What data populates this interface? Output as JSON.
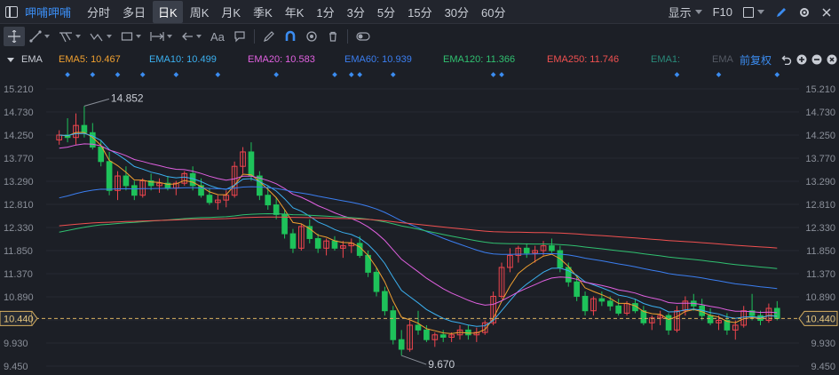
{
  "topbar": {
    "stock_name": "呷哺呷哺",
    "periods": [
      "分时",
      "多日",
      "日K",
      "周K",
      "月K",
      "季K",
      "年K",
      "1分",
      "3分",
      "5分",
      "15分",
      "30分",
      "60分"
    ],
    "active_period": "日K",
    "display_label": "显示",
    "f10_label": "F10"
  },
  "toolbar": {
    "text_tool_label": "Aa"
  },
  "legend": {
    "indicator": "EMA",
    "adjust_label": "前复权",
    "items": [
      {
        "label": "EMA5: 10.467",
        "color": "#f0a030"
      },
      {
        "label": "EMA10: 10.499",
        "color": "#3bb0f0"
      },
      {
        "label": "EMA20: 10.583",
        "color": "#e060e0"
      },
      {
        "label": "EMA60: 10.939",
        "color": "#3b7ef0"
      },
      {
        "label": "EMA120: 11.366",
        "color": "#30c070"
      },
      {
        "label": "EMA250: 11.746",
        "color": "#f05050"
      },
      {
        "label": "EMA1:",
        "color": "#2a8a7a"
      },
      {
        "label": "EMA",
        "color": "#555a64"
      }
    ]
  },
  "chart_data": {
    "type": "candlestick",
    "y_ticks": [
      "15.210",
      "14.730",
      "14.250",
      "13.770",
      "13.290",
      "12.810",
      "12.330",
      "11.850",
      "11.370",
      "10.890",
      "10.410",
      "9.930",
      "9.450"
    ],
    "ylim": [
      9.45,
      15.21
    ],
    "last_price": "10.440",
    "high_label": "14.852",
    "low_label": "9.670",
    "up_color": "#f0454e",
    "down_color": "#1ec25a",
    "ohlc": [
      [
        14.15,
        14.35,
        14.05,
        14.25
      ],
      [
        14.25,
        14.6,
        14.1,
        14.2
      ],
      [
        14.2,
        14.7,
        14.05,
        14.45
      ],
      [
        14.45,
        14.852,
        14.2,
        14.3
      ],
      [
        14.3,
        14.5,
        13.95,
        14.0
      ],
      [
        14.0,
        14.15,
        13.6,
        13.7
      ],
      [
        13.7,
        13.9,
        13.0,
        13.1
      ],
      [
        13.1,
        13.5,
        12.9,
        13.4
      ],
      [
        13.4,
        13.6,
        13.1,
        13.2
      ],
      [
        13.2,
        13.3,
        12.9,
        13.0
      ],
      [
        13.0,
        13.35,
        12.95,
        13.3
      ],
      [
        13.3,
        13.45,
        13.1,
        13.2
      ],
      [
        13.2,
        13.35,
        13.05,
        13.25
      ],
      [
        13.25,
        13.4,
        13.1,
        13.15
      ],
      [
        13.15,
        13.3,
        13.0,
        13.25
      ],
      [
        13.25,
        13.5,
        13.2,
        13.45
      ],
      [
        13.45,
        13.6,
        13.1,
        13.2
      ],
      [
        13.2,
        13.35,
        12.95,
        13.0
      ],
      [
        13.0,
        13.15,
        12.8,
        12.85
      ],
      [
        12.85,
        13.0,
        12.7,
        12.9
      ],
      [
        12.9,
        13.1,
        12.75,
        13.0
      ],
      [
        13.0,
        13.7,
        12.95,
        13.6
      ],
      [
        13.6,
        14.0,
        13.45,
        13.9
      ],
      [
        13.9,
        14.1,
        13.3,
        13.4
      ],
      [
        13.4,
        13.5,
        12.9,
        13.0
      ],
      [
        13.0,
        13.2,
        12.7,
        12.8
      ],
      [
        12.8,
        12.95,
        12.5,
        12.6
      ],
      [
        12.6,
        12.7,
        12.1,
        12.2
      ],
      [
        12.2,
        12.3,
        11.8,
        11.9
      ],
      [
        11.9,
        12.4,
        11.85,
        12.35
      ],
      [
        12.35,
        12.5,
        12.0,
        12.1
      ],
      [
        12.1,
        12.2,
        11.8,
        11.9
      ],
      [
        11.9,
        12.1,
        11.75,
        12.05
      ],
      [
        12.05,
        12.15,
        11.85,
        11.9
      ],
      [
        11.9,
        12.05,
        11.7,
        11.95
      ],
      [
        11.95,
        12.1,
        11.8,
        12.0
      ],
      [
        12.0,
        12.15,
        11.7,
        11.75
      ],
      [
        11.75,
        11.85,
        11.3,
        11.4
      ],
      [
        11.4,
        11.5,
        10.9,
        11.0
      ],
      [
        11.0,
        11.1,
        10.5,
        10.6
      ],
      [
        10.6,
        10.7,
        9.9,
        10.0
      ],
      [
        10.0,
        10.2,
        9.67,
        9.8
      ],
      [
        9.8,
        10.4,
        9.75,
        10.3
      ],
      [
        10.3,
        10.6,
        10.1,
        10.2
      ],
      [
        10.2,
        10.3,
        9.95,
        10.0
      ],
      [
        10.0,
        10.15,
        9.85,
        10.1
      ],
      [
        10.1,
        10.2,
        9.95,
        10.05
      ],
      [
        10.05,
        10.15,
        9.95,
        10.1
      ],
      [
        10.1,
        10.3,
        10.0,
        10.2
      ],
      [
        10.2,
        10.3,
        10.0,
        10.1
      ],
      [
        10.1,
        10.25,
        9.95,
        10.15
      ],
      [
        10.15,
        10.4,
        10.1,
        10.35
      ],
      [
        10.35,
        11.0,
        10.3,
        10.9
      ],
      [
        10.9,
        11.6,
        10.85,
        11.5
      ],
      [
        11.5,
        11.9,
        11.4,
        11.75
      ],
      [
        11.75,
        11.95,
        11.6,
        11.9
      ],
      [
        11.9,
        12.0,
        11.7,
        11.8
      ],
      [
        11.8,
        11.95,
        11.6,
        11.85
      ],
      [
        11.85,
        12.05,
        11.75,
        11.95
      ],
      [
        11.95,
        12.1,
        11.8,
        11.85
      ],
      [
        11.85,
        11.95,
        11.4,
        11.5
      ],
      [
        11.5,
        11.6,
        11.1,
        11.2
      ],
      [
        11.2,
        11.3,
        10.8,
        10.9
      ],
      [
        10.9,
        11.0,
        10.5,
        10.6
      ],
      [
        10.6,
        10.9,
        10.5,
        10.85
      ],
      [
        10.85,
        11.0,
        10.7,
        10.8
      ],
      [
        10.8,
        10.9,
        10.6,
        10.7
      ],
      [
        10.7,
        10.85,
        10.5,
        10.55
      ],
      [
        10.55,
        10.8,
        10.5,
        10.75
      ],
      [
        10.75,
        10.85,
        10.55,
        10.6
      ],
      [
        10.6,
        10.7,
        10.3,
        10.35
      ],
      [
        10.35,
        10.5,
        10.2,
        10.45
      ],
      [
        10.45,
        10.6,
        10.3,
        10.5
      ],
      [
        10.5,
        10.55,
        10.1,
        10.2
      ],
      [
        10.2,
        10.7,
        10.15,
        10.6
      ],
      [
        10.6,
        10.9,
        10.5,
        10.8
      ],
      [
        10.8,
        10.95,
        10.6,
        10.7
      ],
      [
        10.7,
        10.85,
        10.4,
        10.5
      ],
      [
        10.5,
        10.65,
        10.3,
        10.35
      ],
      [
        10.35,
        10.5,
        10.2,
        10.4
      ],
      [
        10.4,
        10.55,
        10.1,
        10.2
      ],
      [
        10.2,
        10.4,
        10.0,
        10.3
      ],
      [
        10.3,
        10.7,
        10.25,
        10.6
      ],
      [
        10.6,
        10.95,
        10.4,
        10.5
      ],
      [
        10.5,
        10.6,
        10.3,
        10.4
      ],
      [
        10.4,
        10.75,
        10.35,
        10.65
      ],
      [
        10.65,
        10.8,
        10.4,
        10.44
      ]
    ]
  }
}
